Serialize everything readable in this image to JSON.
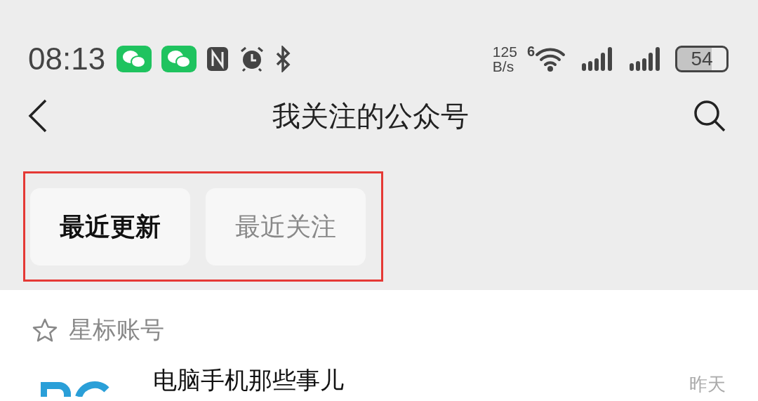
{
  "status_bar": {
    "time": "08:13",
    "net_speed_value": "125",
    "net_speed_unit": "B/s",
    "wifi_badge": "6",
    "battery": "54"
  },
  "header": {
    "title": "我关注的公众号"
  },
  "tabs": [
    {
      "label": "最近更新",
      "selected": true
    },
    {
      "label": "最近关注",
      "selected": false
    }
  ],
  "starred_section": {
    "label": "星标账号"
  },
  "accounts": [
    {
      "name": "电脑手机那些事儿",
      "time": "昨天"
    }
  ]
}
